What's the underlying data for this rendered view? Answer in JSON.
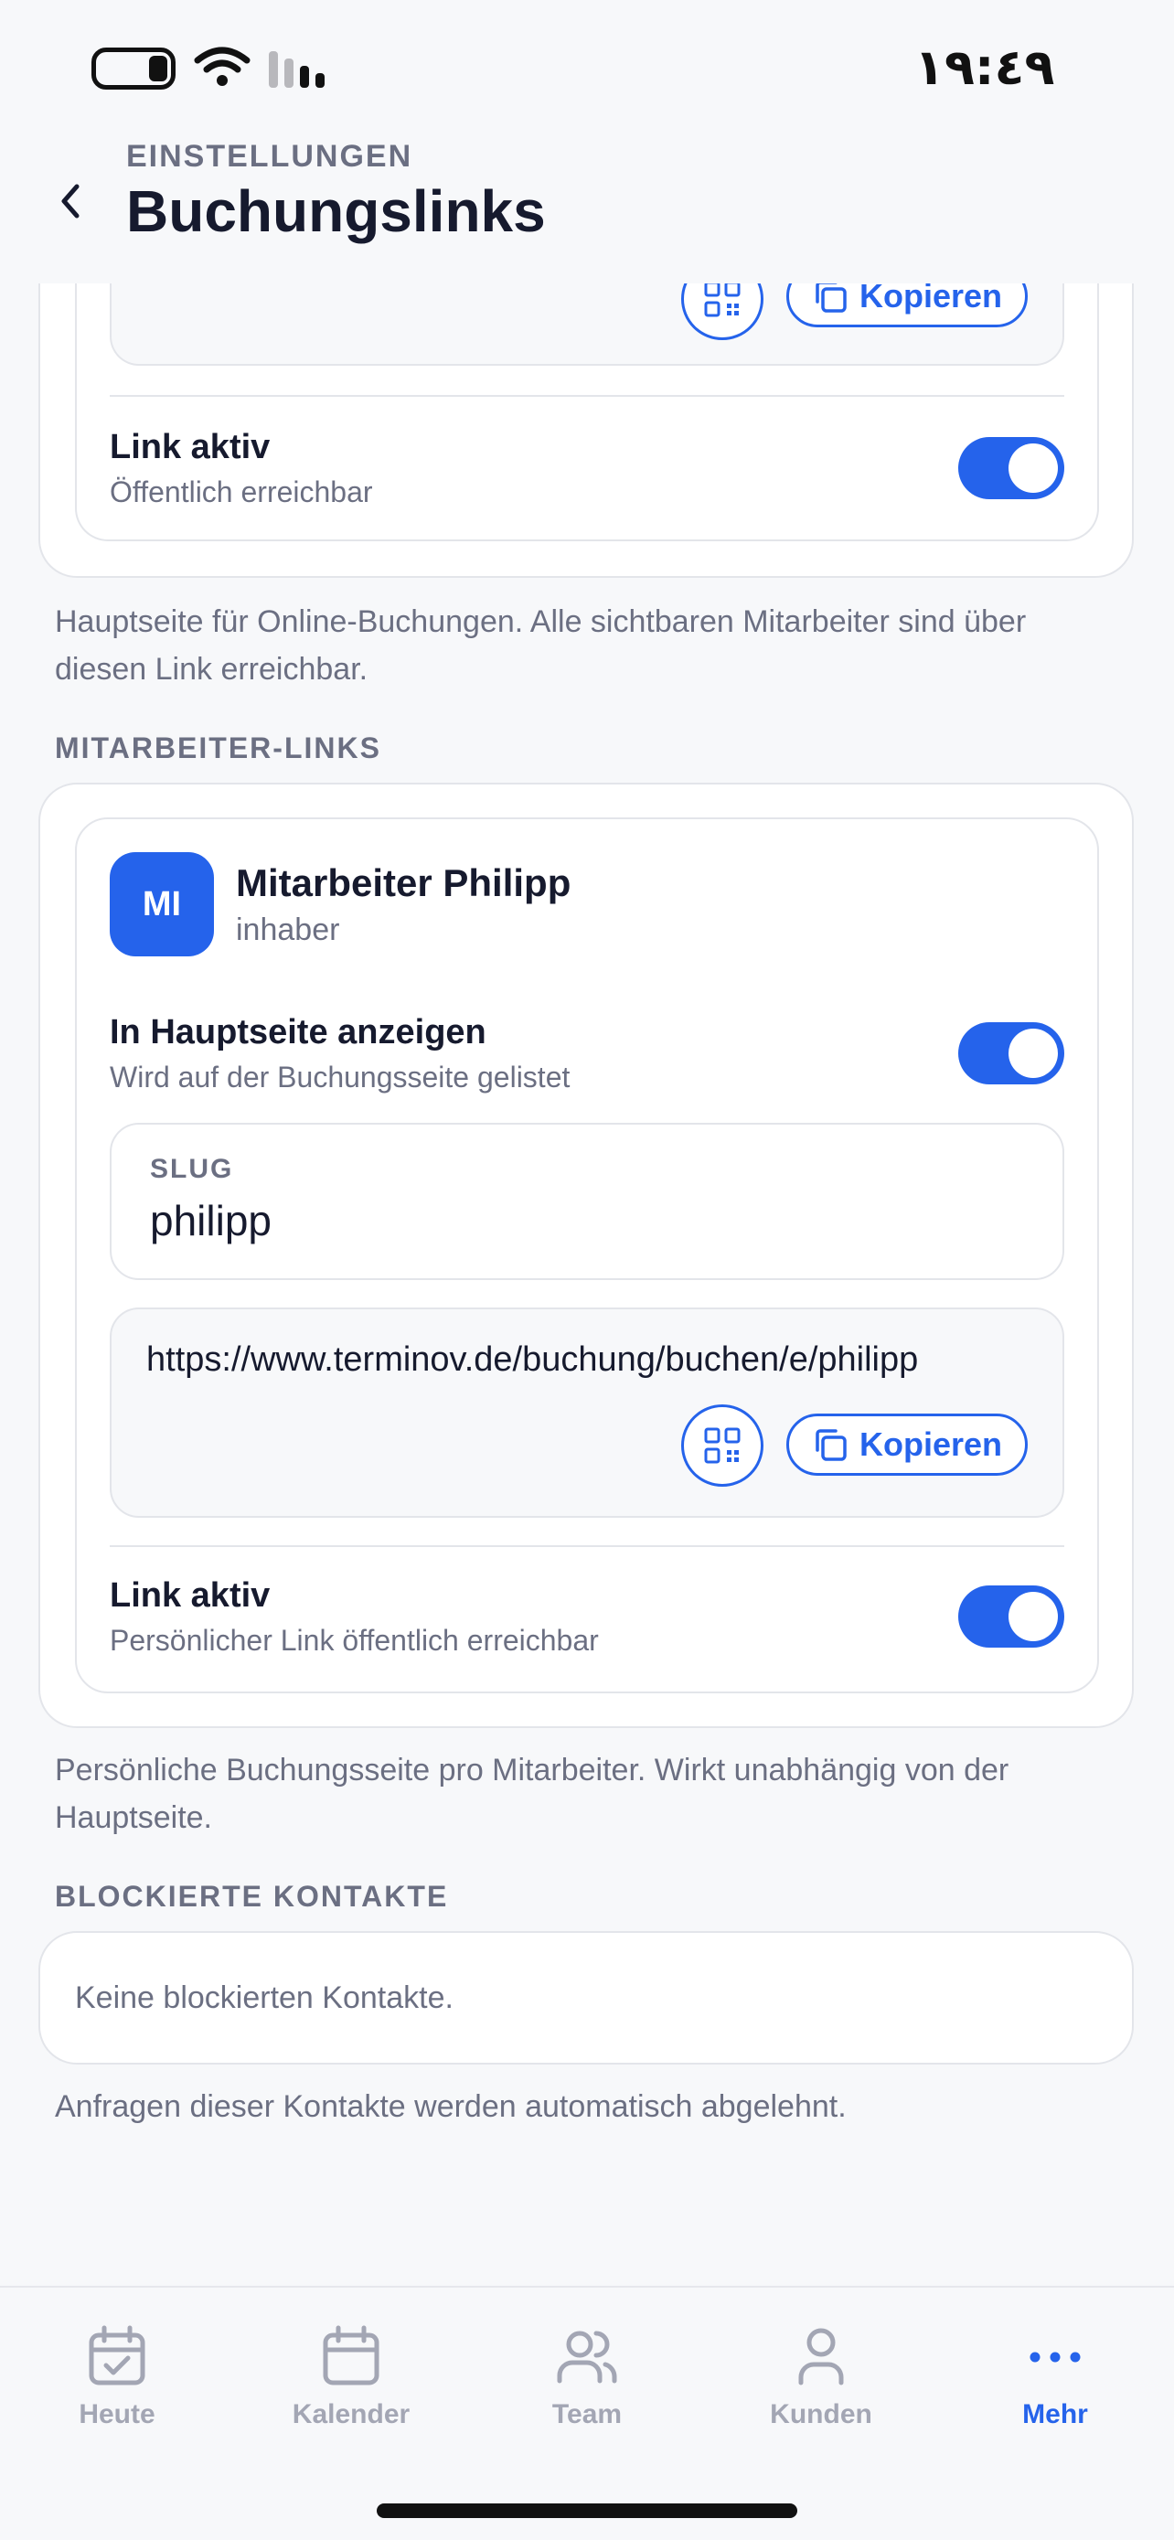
{
  "status_bar": {
    "time": "١٩:٤٩"
  },
  "header": {
    "overline": "EINSTELLUNGEN",
    "title": "Buchungslinks"
  },
  "main_link": {
    "copy_label": "Kopieren",
    "active_title": "Link aktiv",
    "active_subtitle": "Öffentlich erreichbar",
    "active": true
  },
  "main_caption": "Hauptseite für Online-Buchungen. Alle sichtbaren Mitarbeiter sind über diesen Link erreichbar.",
  "staff_section": {
    "label": "MITARBEITER-LINKS",
    "member": {
      "initials": "MI",
      "name": "Mitarbeiter Philipp",
      "role": "inhaber",
      "show_title": "In Hauptseite anzeigen",
      "show_subtitle": "Wird auf der Buchungsseite gelistet",
      "show_enabled": true,
      "slug_label": "SLUG",
      "slug_value": "philipp",
      "url": "https://www.terminov.de/buchung/buchen/e/philipp",
      "copy_label": "Kopieren",
      "active_title": "Link aktiv",
      "active_subtitle": "Persönlicher Link öffentlich erreichbar",
      "active": true
    },
    "caption": "Persönliche Buchungsseite pro Mitarbeiter. Wirkt unabhängig von der Hauptseite."
  },
  "blocked_section": {
    "label": "BLOCKIERTE KONTAKTE",
    "empty_text": "Keine blockierten Kontakte.",
    "caption": "Anfragen dieser Kontakte werden automatisch abgelehnt."
  },
  "tab_bar": {
    "tabs": [
      {
        "label": "Heute",
        "icon": "calendar-check-icon",
        "active": false
      },
      {
        "label": "Kalender",
        "icon": "calendar-icon",
        "active": false
      },
      {
        "label": "Team",
        "icon": "users-icon",
        "active": false
      },
      {
        "label": "Kunden",
        "icon": "user-icon",
        "active": false
      },
      {
        "label": "Mehr",
        "icon": "more-dots-icon",
        "active": true
      }
    ]
  },
  "colors": {
    "accent": "#2563eb",
    "text": "#161a2e",
    "muted": "#6b6f82",
    "background": "#f7f8fa"
  }
}
